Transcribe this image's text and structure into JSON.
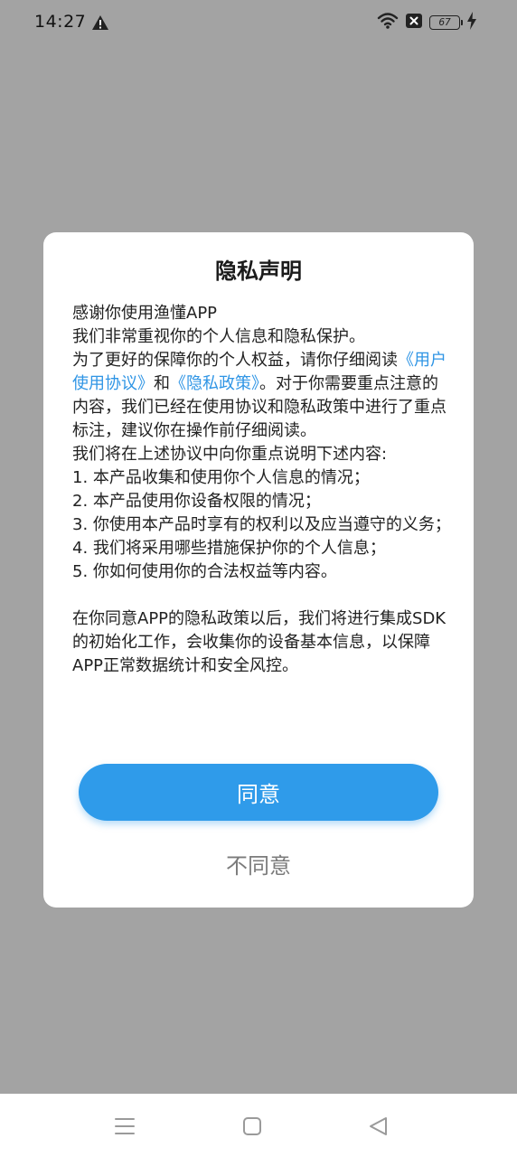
{
  "status_bar": {
    "time": "14:27",
    "battery_level": "67"
  },
  "dialog": {
    "title": "隐私声明",
    "paragraphs": {
      "p1": "感谢你使用渔懂APP",
      "p2": "我们非常重视你的个人信息和隐私保护。",
      "p3_a": "为了更好的保障你的个人权益，请你仔细阅读",
      "link_user_agreement": "《用户使用协议》",
      "p3_b": "和",
      "link_privacy_policy": "《隐私政策》",
      "p3_c": "。对于你需要重点注意的内容，我们已经在使用协议和隐私政策中进行了重点标注，建议你在操作前仔细阅读。",
      "p4": "我们将在上述协议中向你重点说明下述内容:",
      "item1": "1. 本产品收集和使用你个人信息的情况；",
      "item2": "2. 本产品使用你设备权限的情况；",
      "item3": "3. 你使用本产品时享有的权利以及应当遵守的义务；",
      "item4": "4. 我们将采用哪些措施保护你的个人信息；",
      "item5": "5. 你如何使用你的合法权益等内容。",
      "p5": "在你同意APP的隐私政策以后，我们将进行集成SDK的初始化工作，会收集你的设备基本信息，以保障APP正常数据统计和安全风控。"
    },
    "agree_label": "同意",
    "disagree_label": "不同意"
  },
  "colors": {
    "accent": "#2f9bea",
    "link": "#2f95e5",
    "overlay": "#a3a3a3"
  },
  "icons": {
    "status_warning": "warning-icon",
    "wifi": "wifi-icon",
    "sim": "no-sim-icon",
    "charging": "charging-icon",
    "nav_menu": "menu-icon",
    "nav_home": "home-icon",
    "nav_back": "back-icon"
  }
}
